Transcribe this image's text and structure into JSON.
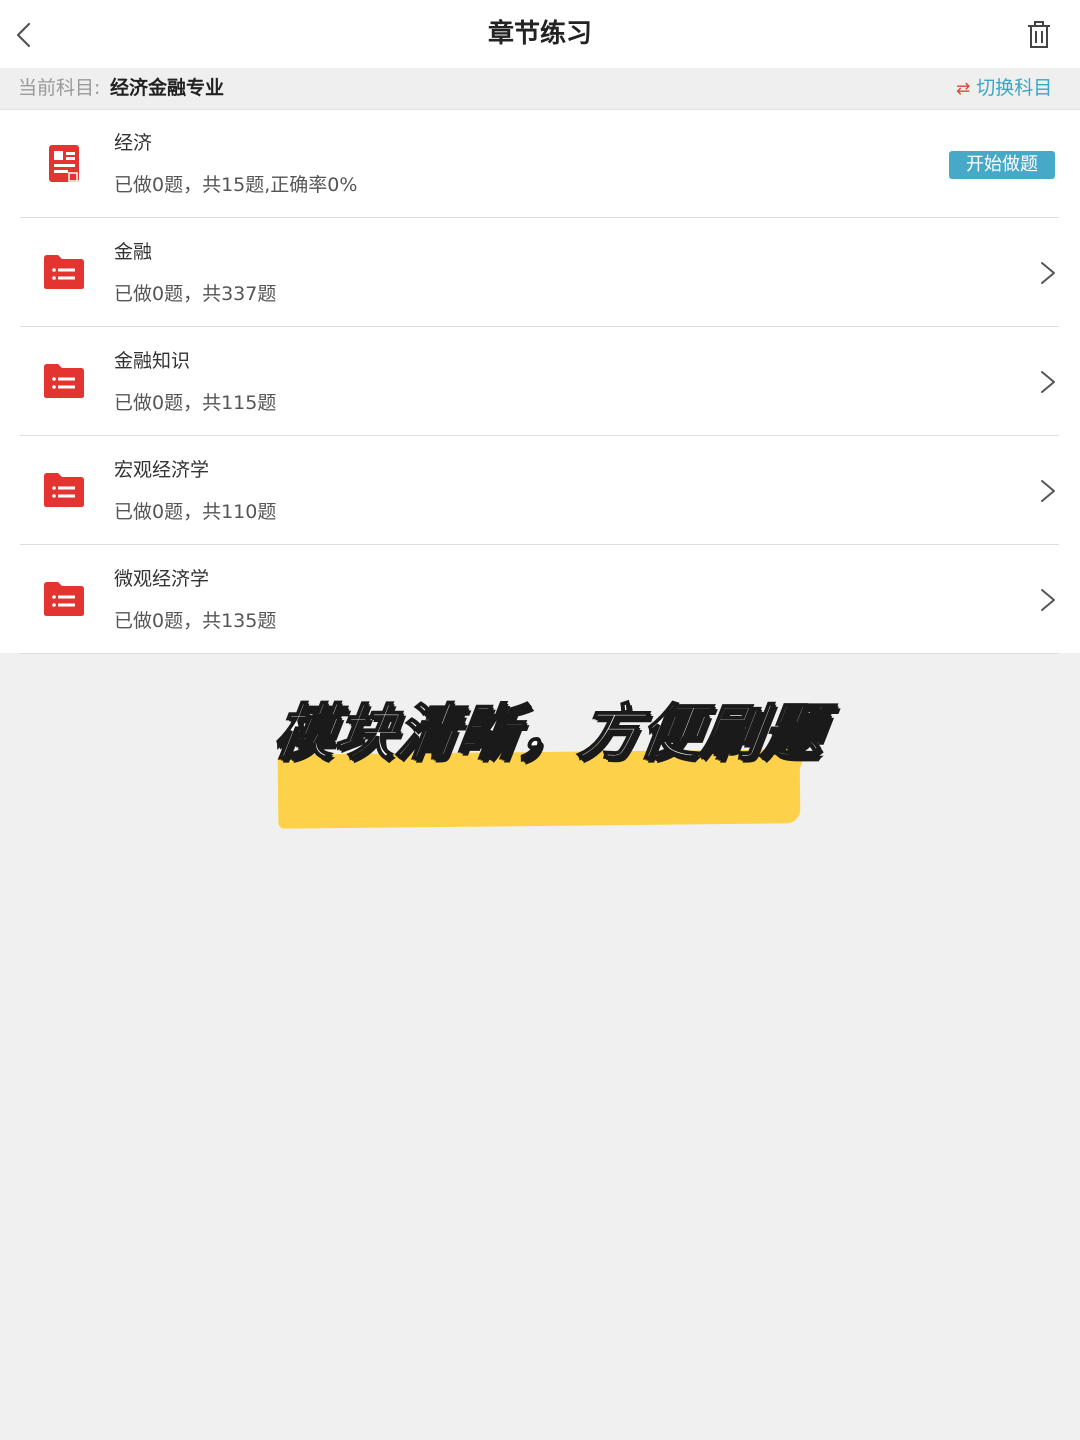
{
  "header": {
    "title": "章节练习",
    "back_icon": "chevron-left-icon",
    "trash_icon": "trash-icon"
  },
  "subject_bar": {
    "label": "当前科目:",
    "value": "经济金融专业",
    "switch_label": "切换科目",
    "switch_icon": "swap-arrows-icon"
  },
  "chapters": [
    {
      "title": "经济",
      "stats": "已做0题，共15题,正确率0%",
      "action_label": "开始做题",
      "icon": "exam-sheet-icon"
    },
    {
      "title": "金融",
      "stats": "已做0题，共337题",
      "icon": "folder-list-icon"
    },
    {
      "title": "金融知识",
      "stats": "已做0题，共115题",
      "icon": "folder-list-icon"
    },
    {
      "title": "宏观经济学",
      "stats": "已做0题，共110题",
      "icon": "folder-list-icon"
    },
    {
      "title": "微观经济学",
      "stats": "已做0题，共135题",
      "icon": "folder-list-icon"
    }
  ],
  "banner": {
    "text": "模块清晰，方便刷题"
  },
  "colors": {
    "accent": "#45a9c7",
    "icon_red": "#e3342f",
    "highlight": "#fdd24a",
    "background": "#f0f0f0"
  }
}
